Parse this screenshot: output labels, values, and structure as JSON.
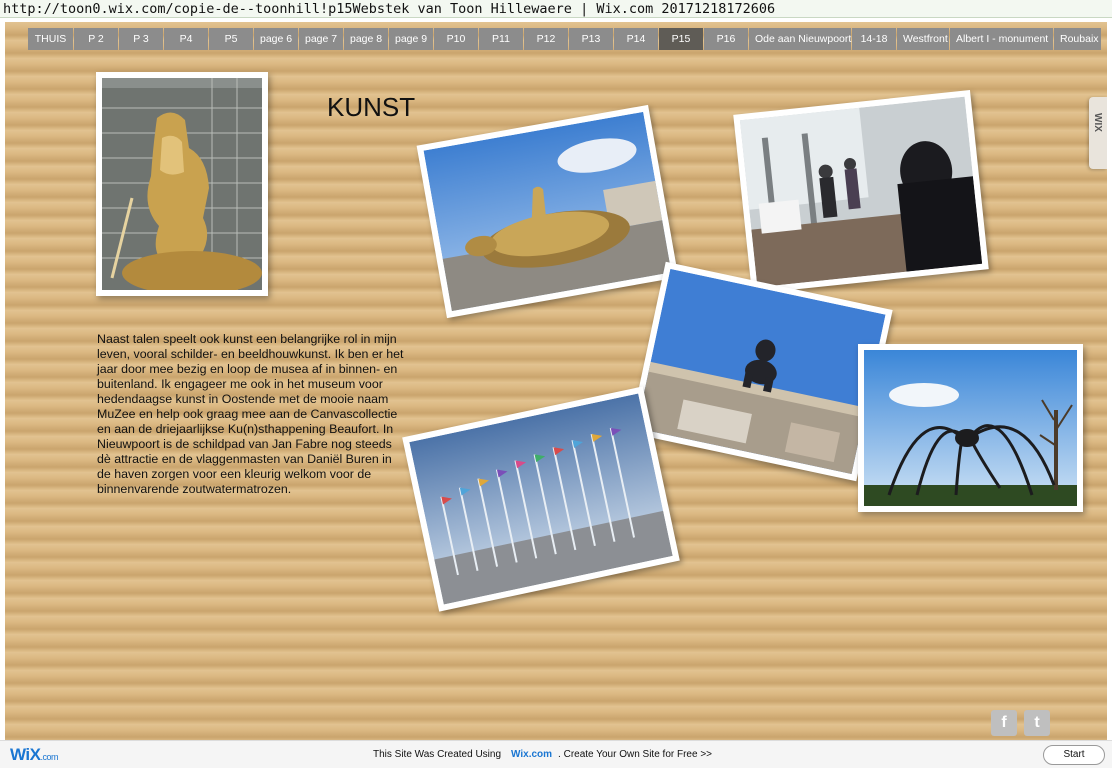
{
  "window": {
    "title": "http://toon0.wix.com/copie-de--toonhill!p15Webstek van Toon Hillewaere | Wix.com 20171218172606"
  },
  "nav": {
    "items": [
      {
        "label": "THUIS"
      },
      {
        "label": "P 2"
      },
      {
        "label": "P 3"
      },
      {
        "label": "P4"
      },
      {
        "label": "P5"
      },
      {
        "label": "page 6"
      },
      {
        "label": "page 7"
      },
      {
        "label": "page 8"
      },
      {
        "label": "page 9"
      },
      {
        "label": "P10"
      },
      {
        "label": "P11"
      },
      {
        "label": "P12"
      },
      {
        "label": "P13"
      },
      {
        "label": "P14"
      },
      {
        "label": "P15"
      },
      {
        "label": "P16"
      },
      {
        "label": "Ode aan Nieuwpoort"
      },
      {
        "label": "14-18"
      },
      {
        "label": "Westfront"
      },
      {
        "label": "Albert  I - monument"
      },
      {
        "label": "Roubaix"
      }
    ],
    "active": "P15"
  },
  "content": {
    "title": "KUNST",
    "body": "Naast talen speelt ook kunst een belangrijke rol in mijn leven, vooral schilder- en beeldhouwkunst. Ik ben er het jaar door mee bezig en loop de musea af in binnen- en buitenland. Ik engageer me ook in het museum voor hedendaagse kunst in Oostende met de mooie naam MuZee en help ook graag mee aan de Canvascollectie en aan de driejaarlijkse Ku(n)sthappening Beaufort. In Nieuwpoort is de schildpad van Jan Fabre nog steeds dè attractie en de vlaggenmasten van Daniël Buren in de haven zorgen voor een kleurig welkom voor de binnenvarende zoutwatermatrozen."
  },
  "photos": [
    {
      "name": "golden-rider-statue"
    },
    {
      "name": "golden-turtle-sculpture"
    },
    {
      "name": "restaurant-interior"
    },
    {
      "name": "baby-sculpture-on-roof"
    },
    {
      "name": "spider-sculpture"
    },
    {
      "name": "flag-poles-harbour"
    }
  ],
  "sidebar": {
    "wix_tab_label": "WIX"
  },
  "social": {
    "facebook": "f",
    "twitter": "t"
  },
  "footer": {
    "logo_main": "WiX",
    "logo_suffix": ".com",
    "text_before": "This Site Was Created Using",
    "link": "Wix.com",
    "text_after": ". Create Your Own Site for Free >>",
    "start_label": "Start"
  },
  "colors": {
    "background": "#d7b27a",
    "nav_button": "#8c8c8c",
    "nav_active": "#5f5c56",
    "link": "#1a76d2"
  }
}
